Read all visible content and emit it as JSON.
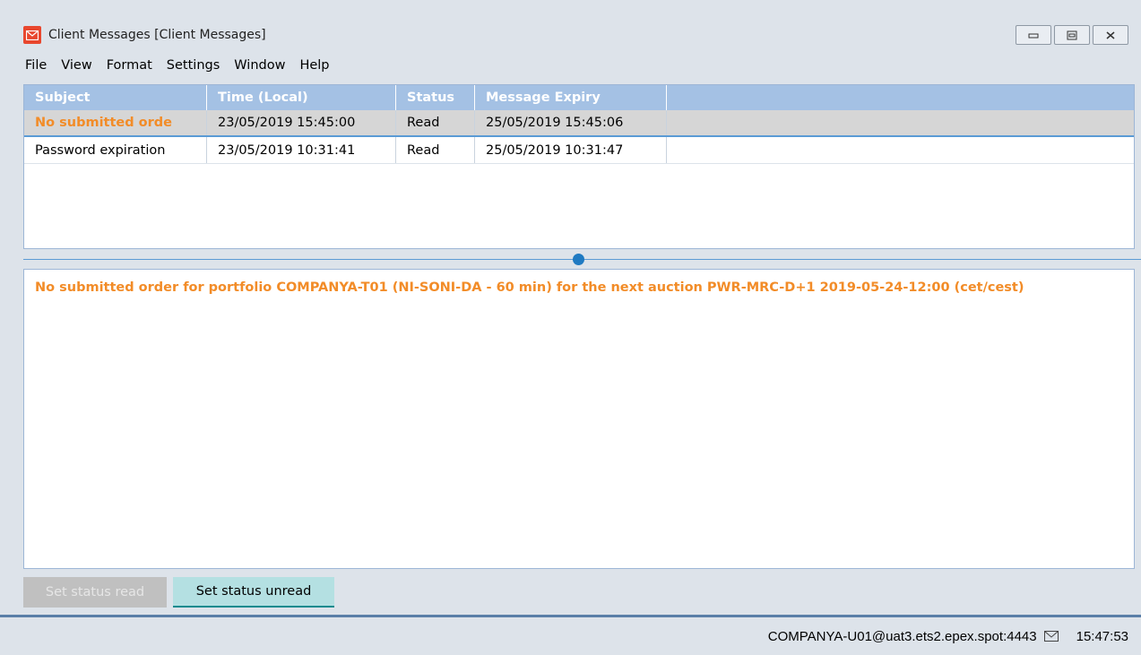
{
  "window": {
    "title": "Client Messages [Client Messages]",
    "controls": [
      "minimize",
      "restore",
      "close"
    ]
  },
  "menu": {
    "items": [
      "File",
      "View",
      "Format",
      "Settings",
      "Window",
      "Help"
    ]
  },
  "messages_table": {
    "columns": [
      "Subject",
      "Time (Local)",
      "Status",
      "Message Expiry"
    ],
    "rows": [
      {
        "subject": "No submitted orde",
        "time": "23/05/2019 15:45:00",
        "status": "Read",
        "expiry": "25/05/2019 15:45:06",
        "selected": true
      },
      {
        "subject": "Password expiration",
        "time": "23/05/2019 10:31:41",
        "status": "Read",
        "expiry": "25/05/2019 10:31:47",
        "selected": false
      }
    ]
  },
  "detail": {
    "message": "No submitted order for portfolio COMPANYA-T01 (NI-SONI-DA - 60 min) for the next auction PWR-MRC-D+1 2019-05-24-12:00 (cet/cest)"
  },
  "buttons": {
    "set_read": "Set status read",
    "set_unread": "Set status unread"
  },
  "statusbar": {
    "connection": "COMPANYA-U01@uat3.ets2.epex.spot:4443",
    "time": "15:47:53"
  },
  "colors": {
    "accent": "#f28c28",
    "header_bg": "#a4c1e4",
    "app_icon": "#e8472e"
  },
  "icons": {
    "app": "envelope-icon",
    "status": "mail-icon"
  }
}
